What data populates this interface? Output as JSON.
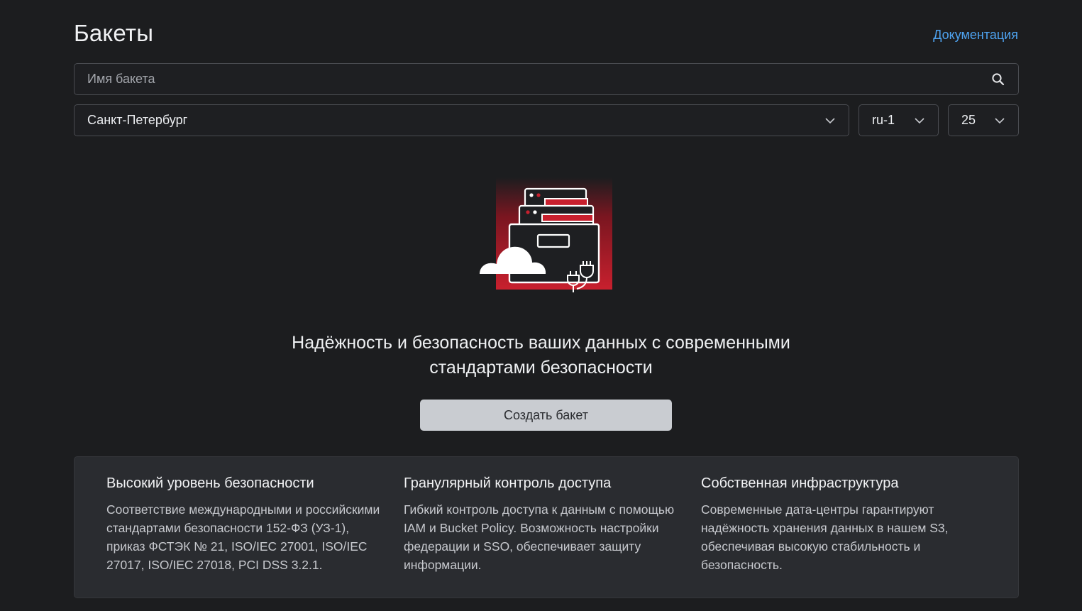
{
  "header": {
    "title": "Бакеты",
    "docs_link": "Документация"
  },
  "search": {
    "placeholder": "Имя бакета",
    "value": ""
  },
  "filters": {
    "region": "Санкт-Петербург",
    "zone": "ru-1",
    "page_size": "25"
  },
  "empty_state": {
    "headline_line1": "Надёжность и безопасность ваших данных с современными",
    "headline_line2": "стандартами безопасности",
    "create_button": "Создать бакет"
  },
  "features": [
    {
      "title": "Высокий уровень безопасности",
      "text": "Соответствие международными и российскими стандартами безопасности 152-ФЗ (УЗ-1), приказ ФСТЭК № 21, ISO/IEC 27001, ISO/IEC 27017, ISO/IEC 27018, PCI DSS 3.2.1."
    },
    {
      "title": "Гранулярный контроль доступа",
      "text": "Гибкий контроль доступа к данным с помощью IAM и Bucket Policy. Возможность настройки федерации и SSO, обеспечивает защиту информации."
    },
    {
      "title": "Собственная инфраструктура",
      "text": "Современные дата-центры гарантируют надёжность хранения данных в нашем S3, обеспечивая высокую стабильность и безопасность."
    }
  ],
  "icons": {
    "search": "search-icon",
    "dropdown": "chevron-down-icon"
  },
  "colors": {
    "background": "#1c1d1f",
    "link": "#4ea3f0",
    "accent_red": "#c8202e",
    "button_bg": "#c9ccd1",
    "panel_bg": "#2a2c30"
  }
}
